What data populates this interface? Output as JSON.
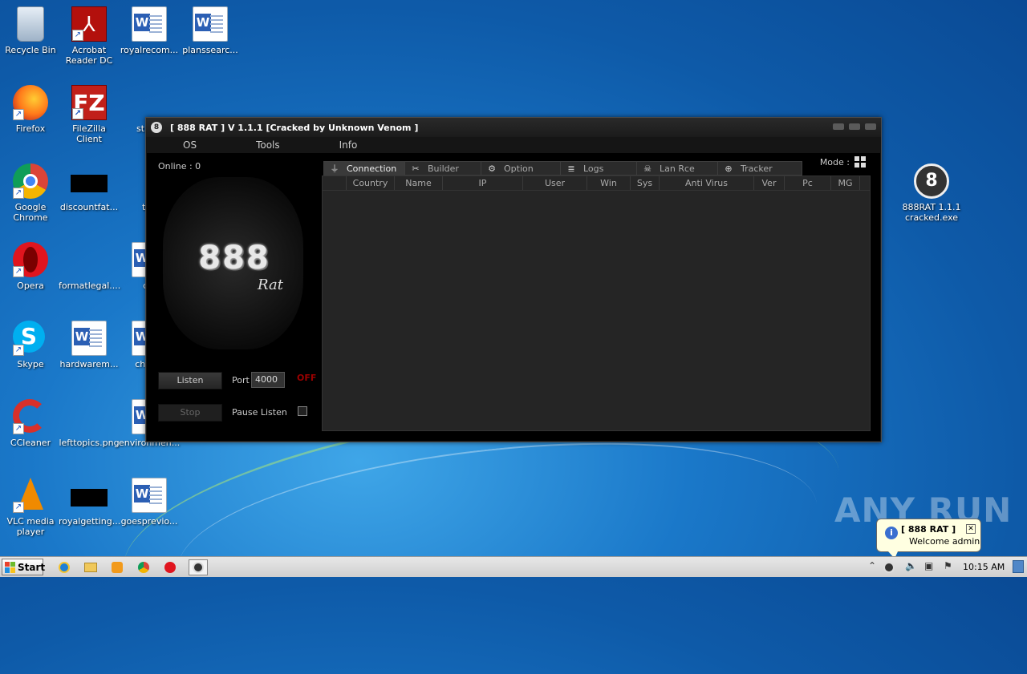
{
  "desktop": {
    "icons": [
      {
        "label": "Recycle Bin"
      },
      {
        "label": "Acrobat Reader DC"
      },
      {
        "label": "royalrecom..."
      },
      {
        "label": "planssearc..."
      },
      {
        "label": "Firefox"
      },
      {
        "label": "FileZilla Client"
      },
      {
        "label": "struct"
      },
      {
        "label": "Google Chrome"
      },
      {
        "label": "discountfat..."
      },
      {
        "label": "the"
      },
      {
        "label": "Opera"
      },
      {
        "label": "formatlegal...."
      },
      {
        "label": "cal"
      },
      {
        "label": "Skype"
      },
      {
        "label": "hardwarem..."
      },
      {
        "label": "choice"
      },
      {
        "label": "CCleaner"
      },
      {
        "label": "lefttopics.png"
      },
      {
        "label": "environmen..."
      },
      {
        "label": "VLC media player"
      },
      {
        "label": "royalgetting..."
      },
      {
        "label": "goesprevio..."
      },
      {
        "label": "888RAT 1.1.1 cracked.exe"
      }
    ]
  },
  "window": {
    "title": "[ 888 RAT ] V 1.1.1 [Cracked by Unknown Venom ]",
    "menu": [
      "OS",
      "Tools",
      "Info"
    ],
    "online_label": "Online : 0",
    "logo_number": "888",
    "logo_word": "Rat",
    "listen_label": "Listen",
    "stop_label": "Stop",
    "port_label": "Port",
    "port_value": "4000",
    "status": "OFF",
    "pause_label": "Pause Listen",
    "mode_label": "Mode :",
    "tabs": [
      {
        "label": "Connection",
        "icon": "plug-icon",
        "glyph": "⏚"
      },
      {
        "label": "Builder",
        "icon": "tools-icon",
        "glyph": "✂"
      },
      {
        "label": "Option",
        "icon": "gear-icon",
        "glyph": "⚙"
      },
      {
        "label": "Logs",
        "icon": "database-icon",
        "glyph": "≣"
      },
      {
        "label": "Lan Rce",
        "icon": "skull-icon",
        "glyph": "☠"
      },
      {
        "label": "Tracker",
        "icon": "globe-icon",
        "glyph": "⊕"
      }
    ],
    "columns": [
      "",
      "Country",
      "Name",
      "IP",
      "User",
      "Win",
      "Sys",
      "Anti Virus",
      "Ver",
      "Pc",
      "MG"
    ]
  },
  "notification": {
    "title": "[ 888 RAT ]",
    "message": "Welcome admin"
  },
  "watermark": "ANY RUN",
  "taskbar": {
    "start_label": "Start",
    "clock": "10:15 AM"
  },
  "colors": {
    "status_off": "#9b0000",
    "balloon": "#ffffe1"
  }
}
